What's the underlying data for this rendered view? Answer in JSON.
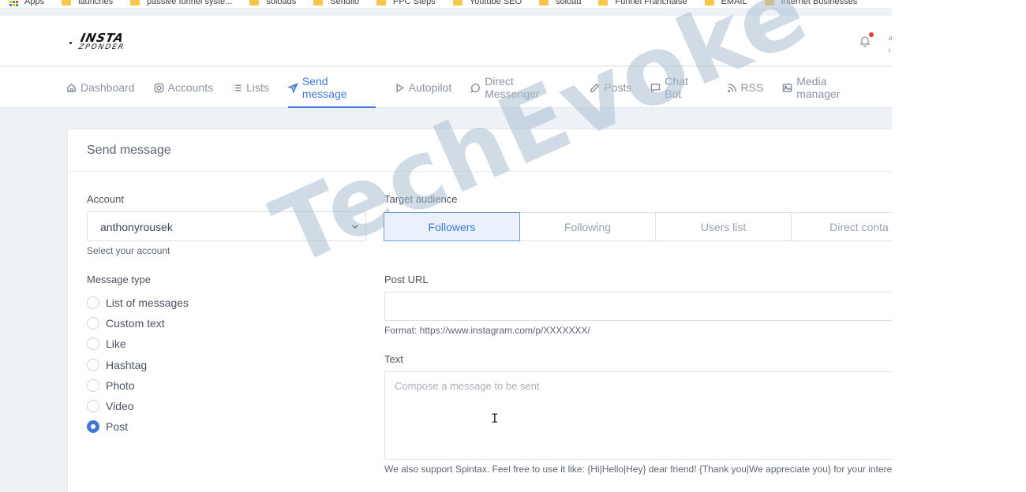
{
  "bookmarks": [
    "Apps",
    "launches",
    "passive funnel syste...",
    "soloads",
    "Sendiio",
    "PPC Steps",
    "Youtube SEO",
    "soload",
    "Funnel Franchaise",
    "EMAIL",
    "Internet Businesses"
  ],
  "logo": {
    "line1": "INSTA",
    "line2": "ZPONDER"
  },
  "user_stub": "a\ni",
  "nav": [
    {
      "label": "Dashboard",
      "icon": "home-icon"
    },
    {
      "label": "Accounts",
      "icon": "instagram-icon"
    },
    {
      "label": "Lists",
      "icon": "list-icon"
    },
    {
      "label": "Send message",
      "icon": "send-icon",
      "active": true
    },
    {
      "label": "Autopilot",
      "icon": "play-icon"
    },
    {
      "label": "Direct Messenger",
      "icon": "chat-bubble-icon"
    },
    {
      "label": "Posts",
      "icon": "pencil-icon"
    },
    {
      "label": "Chat Bot",
      "icon": "message-square-icon"
    },
    {
      "label": "RSS",
      "icon": "rss-icon"
    },
    {
      "label": "Media manager",
      "icon": "image-icon"
    }
  ],
  "card": {
    "title": "Send message",
    "account_label": "Account",
    "account_value": "anthonyrousek",
    "account_help": "Select your account",
    "message_type_label": "Message type",
    "message_types": [
      {
        "label": "List of messages",
        "checked": false
      },
      {
        "label": "Custom text",
        "checked": false
      },
      {
        "label": "Like",
        "checked": false
      },
      {
        "label": "Hashtag",
        "checked": false
      },
      {
        "label": "Photo",
        "checked": false
      },
      {
        "label": "Video",
        "checked": false
      },
      {
        "label": "Post",
        "checked": true
      }
    ],
    "target_label": "Target audience",
    "targets": [
      {
        "label": "Followers",
        "active": true
      },
      {
        "label": "Following",
        "active": false
      },
      {
        "label": "Users list",
        "active": false
      },
      {
        "label": "Direct conta",
        "active": false
      }
    ],
    "post_url_label": "Post URL",
    "post_url_value": "",
    "post_url_help": "Format: https://www.instagram.com/p/XXXXXXX/",
    "text_label": "Text",
    "text_placeholder": "Compose a message to be sent",
    "spintax_help": "We also support Spintax. Feel free to use it like: {Hi|Hello|Hey} dear friend! {Thank you|We appreciate you} for your interes"
  },
  "watermark": "TechEvoke",
  "colors": {
    "accent": "#3f78d8",
    "notification": "#e53935",
    "input_accent": "#7cb342"
  }
}
